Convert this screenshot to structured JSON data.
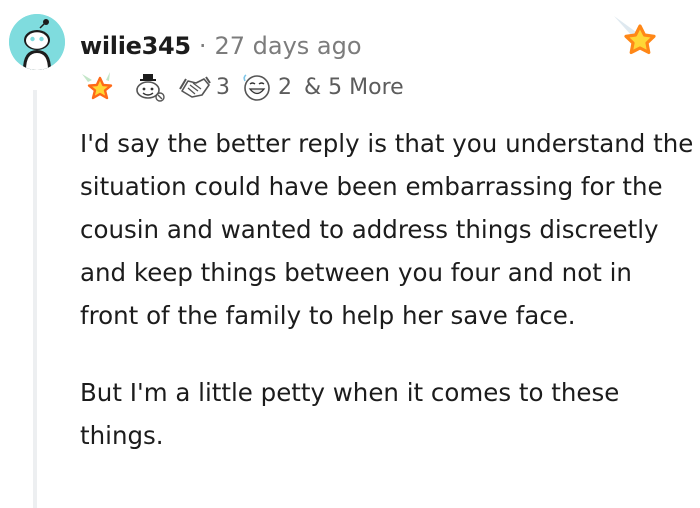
{
  "comment": {
    "username": "wilie345",
    "separator": "·",
    "timestamp": "27 days ago",
    "awards": {
      "items": [
        {
          "icon": "star-burst-award-icon",
          "count": ""
        },
        {
          "icon": "wholesome-award-icon",
          "count": ""
        },
        {
          "icon": "handshake-award-icon",
          "count": "3"
        },
        {
          "icon": "laughing-face-award-icon",
          "count": "2"
        }
      ],
      "more_label": "& 5 More"
    },
    "paragraphs": [
      "I'd say the better reply is that you understand the situation could have been embarrassing for the cousin and wanted to address things discreetly and keep things between you four and not in front of the family to help her save face.",
      "But I'm a little petty when it comes to these things."
    ],
    "avatar_icon": "reddit-snoo-icon",
    "give_award_icon": "shooting-star-icon"
  },
  "colors": {
    "avatar_bg": "#7fdcde",
    "text": "#1c1c1c",
    "meta": "#7c7c7c",
    "thread_line": "#edeff1",
    "star_orange": "#ff8717",
    "star_yellow": "#ffd635"
  }
}
